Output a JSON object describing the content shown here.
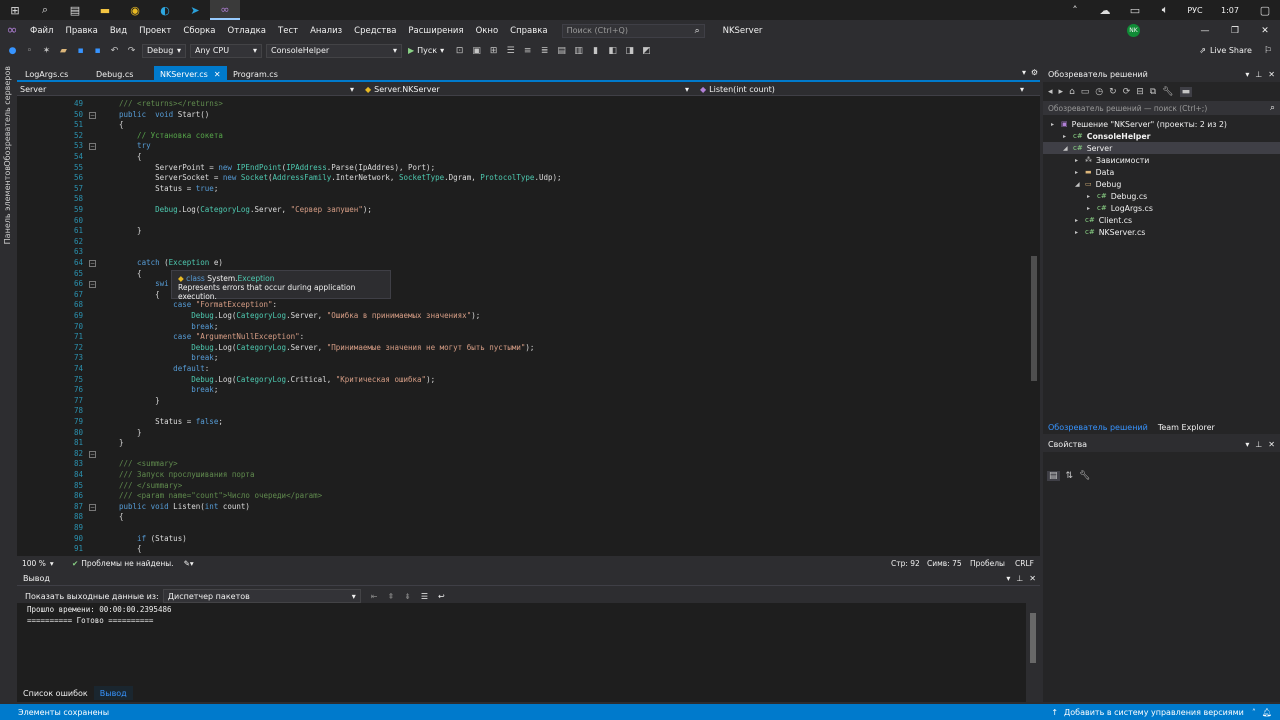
{
  "taskbar": {
    "lang": "РУС",
    "time": "1:07"
  },
  "menu": {
    "items": [
      "Файл",
      "Правка",
      "Вид",
      "Проект",
      "Сборка",
      "Отладка",
      "Тест",
      "Анализ",
      "Средства",
      "Расширения",
      "Окно",
      "Справка"
    ],
    "search_placeholder": "Поиск (Ctrl+Q)",
    "solution_name": "NKServer",
    "user_initials": "NK",
    "live_share": "Live Share"
  },
  "toolbar": {
    "config": "Debug",
    "platform": "Any CPU",
    "startup": "ConsoleHelper",
    "run_label": "Пуск"
  },
  "left_strip": {
    "server_explorer": "Обозреватель серверов",
    "toolbox": "Панель элементов"
  },
  "tabs": [
    {
      "label": "LogArgs.cs",
      "active": false
    },
    {
      "label": "Debug.cs",
      "active": false
    },
    {
      "label": "NKServer.cs",
      "active": true
    },
    {
      "label": "Program.cs",
      "active": false
    }
  ],
  "nav": {
    "project": "Server",
    "type": "Server.NKServer",
    "member": "Listen(int count)"
  },
  "code": {
    "first_line": 49,
    "lines": [
      [
        [
          "xd",
          "/// <returns></returns>"
        ]
      ],
      [
        [
          "kw",
          "public"
        ],
        [
          "",
          "  "
        ],
        [
          "kw",
          "void"
        ],
        [
          "",
          " Start()"
        ]
      ],
      [
        [
          "",
          "{"
        ]
      ],
      [
        [
          "cm",
          "    // Установка сокета"
        ]
      ],
      [
        [
          "kw",
          "    try"
        ]
      ],
      [
        [
          "",
          "    {"
        ]
      ],
      [
        [
          "",
          "        ServerPoint = "
        ],
        [
          "kw",
          "new"
        ],
        [
          "",
          " "
        ],
        [
          "ty",
          "IPEndPoint"
        ],
        [
          "",
          "("
        ],
        [
          "ty",
          "IPAddress"
        ],
        [
          "",
          ".Parse(IpAddres), Port);"
        ]
      ],
      [
        [
          "",
          "        ServerSocket = "
        ],
        [
          "kw",
          "new"
        ],
        [
          "",
          " "
        ],
        [
          "ty",
          "Socket"
        ],
        [
          "",
          "("
        ],
        [
          "ty",
          "AddressFamily"
        ],
        [
          "",
          ".InterNetwork, "
        ],
        [
          "ty",
          "SocketType"
        ],
        [
          "",
          ".Dgram, "
        ],
        [
          "ty",
          "ProtocolType"
        ],
        [
          "",
          ".Udp);"
        ]
      ],
      [
        [
          "",
          "        Status = "
        ],
        [
          "kw",
          "true"
        ],
        [
          "",
          ";"
        ]
      ],
      [
        [
          "",
          ""
        ]
      ],
      [
        [
          "",
          "        "
        ],
        [
          "ty",
          "Debug"
        ],
        [
          "",
          ".Log("
        ],
        [
          "ty",
          "CategoryLog"
        ],
        [
          "",
          ".Server, "
        ],
        [
          "st",
          "\"Сервер запушен\""
        ],
        [
          "",
          ");"
        ]
      ],
      [
        [
          "",
          ""
        ]
      ],
      [
        [
          "",
          "    }"
        ]
      ],
      [
        [
          "",
          ""
        ]
      ],
      [
        [
          "",
          ""
        ]
      ],
      [
        [
          "kw",
          "    catch"
        ],
        [
          "",
          " ("
        ],
        [
          "ty",
          "Exception"
        ],
        [
          "",
          " e)"
        ]
      ],
      [
        [
          "",
          "    {"
        ]
      ],
      [
        [
          "kw",
          "        swi"
        ]
      ],
      [
        [
          "",
          "        {"
        ]
      ],
      [
        [
          "kw",
          "            case"
        ],
        [
          "",
          " "
        ],
        [
          "st",
          "\"FormatException\""
        ],
        [
          "",
          ":"
        ]
      ],
      [
        [
          "",
          "                "
        ],
        [
          "ty",
          "Debug"
        ],
        [
          "",
          ".Log("
        ],
        [
          "ty",
          "CategoryLog"
        ],
        [
          "",
          ".Server, "
        ],
        [
          "st",
          "\"Ошибка в принимаемых значениях\""
        ],
        [
          "",
          ");"
        ]
      ],
      [
        [
          "kw",
          "                break"
        ],
        [
          "",
          ";"
        ]
      ],
      [
        [
          "kw",
          "            case"
        ],
        [
          "",
          " "
        ],
        [
          "st",
          "\"ArgumentNullException\""
        ],
        [
          "",
          ":"
        ]
      ],
      [
        [
          "",
          "                "
        ],
        [
          "ty",
          "Debug"
        ],
        [
          "",
          ".Log("
        ],
        [
          "ty",
          "CategoryLog"
        ],
        [
          "",
          ".Server, "
        ],
        [
          "st",
          "\"Принимаемые значения не могут быть пустыми\""
        ],
        [
          "",
          ");"
        ]
      ],
      [
        [
          "kw",
          "                break"
        ],
        [
          "",
          ";"
        ]
      ],
      [
        [
          "kw",
          "            default"
        ],
        [
          "",
          ":"
        ]
      ],
      [
        [
          "",
          "                "
        ],
        [
          "ty",
          "Debug"
        ],
        [
          "",
          ".Log("
        ],
        [
          "ty",
          "CategoryLog"
        ],
        [
          "",
          ".Critical, "
        ],
        [
          "st",
          "\"Критическая ошибка\""
        ],
        [
          "",
          ");"
        ]
      ],
      [
        [
          "kw",
          "                break"
        ],
        [
          "",
          ";"
        ]
      ],
      [
        [
          "",
          "        }"
        ]
      ],
      [
        [
          "",
          ""
        ]
      ],
      [
        [
          "",
          "        Status = "
        ],
        [
          "kw",
          "false"
        ],
        [
          "",
          ";"
        ]
      ],
      [
        [
          "",
          "    }"
        ]
      ],
      [
        [
          "",
          "}"
        ]
      ],
      [
        [
          "",
          ""
        ]
      ],
      [
        [
          "xd",
          "/// <summary>"
        ]
      ],
      [
        [
          "xd",
          "/// Запуск прослушивания порта"
        ]
      ],
      [
        [
          "xd",
          "/// </summary>"
        ]
      ],
      [
        [
          "xd",
          "/// <param name=\"count\">Число очереди</param>"
        ]
      ],
      [
        [
          "kw",
          "public"
        ],
        [
          "",
          " "
        ],
        [
          "kw",
          "void"
        ],
        [
          "",
          " Listen("
        ],
        [
          "kw",
          "int"
        ],
        [
          "",
          " count)"
        ]
      ],
      [
        [
          "",
          "{"
        ]
      ],
      [
        [
          "",
          ""
        ]
      ],
      [
        [
          "kw",
          "    if"
        ],
        [
          "",
          " (Status)"
        ]
      ],
      [
        [
          "",
          "    {"
        ]
      ]
    ]
  },
  "tooltip": {
    "kind": "class",
    "namespace": "System.",
    "name": "Exception",
    "description": "Represents errors that occur during application execution."
  },
  "editor_status": {
    "zoom": "100 %",
    "issues": "Проблемы не найдены.",
    "line": "Стр: 92",
    "column": "Симв: 75",
    "whitespace": "Пробелы",
    "eol": "CRLF"
  },
  "output": {
    "title": "Вывод",
    "show_from_label": "Показать выходные данные из:",
    "source": "Диспетчер пакетов",
    "lines": [
      "Прошло времени: 00:00:00.2395486",
      "========== Готово =========="
    ]
  },
  "bottom_tabs": [
    {
      "label": "Список ошибок",
      "active": false
    },
    {
      "label": "Вывод",
      "active": true
    }
  ],
  "solution_explorer": {
    "title": "Обозреватель решений",
    "search_placeholder": "Обозреватель решений — поиск (Ctrl+;)",
    "tree": [
      {
        "label": "Решение \"NKServer\" (проекты: 2 из 2)",
        "level": 0,
        "bold": false,
        "icon": "solution-icon"
      },
      {
        "label": "ConsoleHelper",
        "level": 1,
        "bold": true,
        "icon": "csproj-icon"
      },
      {
        "label": "Server",
        "level": 1,
        "bold": false,
        "icon": "csproj-icon",
        "selected": true
      },
      {
        "label": "Зависимости",
        "level": 2,
        "bold": false,
        "icon": "dependencies-icon"
      },
      {
        "label": "Data",
        "level": 2,
        "bold": false,
        "icon": "folder-icon"
      },
      {
        "label": "Debug",
        "level": 2,
        "bold": false,
        "icon": "folder-open-icon"
      },
      {
        "label": "Debug.cs",
        "level": 3,
        "bold": false,
        "icon": "csharp-file-icon"
      },
      {
        "label": "LogArgs.cs",
        "level": 3,
        "bold": false,
        "icon": "csharp-file-icon"
      },
      {
        "label": "Client.cs",
        "level": 2,
        "bold": false,
        "icon": "csharp-file-icon"
      },
      {
        "label": "NKServer.cs",
        "level": 2,
        "bold": false,
        "icon": "csharp-file-icon"
      }
    ],
    "tab_solution": "Обозреватель решений",
    "tab_team": "Team Explorer"
  },
  "properties": {
    "title": "Свойства"
  },
  "statusbar": {
    "message": "Элементы сохранены",
    "vcs": "Добавить в систему управления версиями"
  }
}
